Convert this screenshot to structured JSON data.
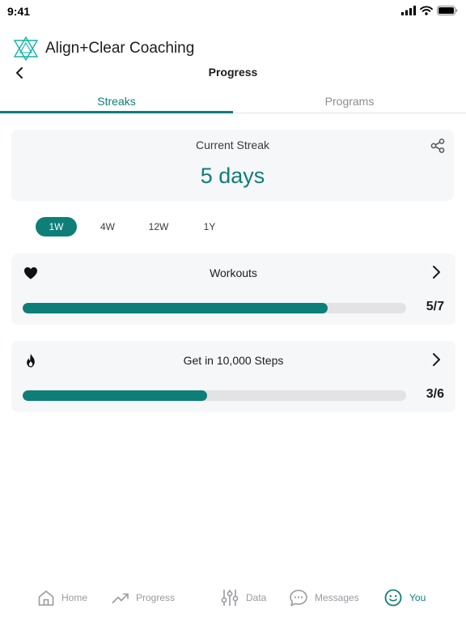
{
  "status_bar": {
    "time": "9:41"
  },
  "brand": {
    "name": "Align+Clear Coaching",
    "accent": "#13b3a8"
  },
  "header": {
    "title": "Progress"
  },
  "tabs": [
    {
      "label": "Streaks",
      "active": true
    },
    {
      "label": "Programs",
      "active": false
    }
  ],
  "streak": {
    "label": "Current Streak",
    "value": "5 days"
  },
  "ranges": [
    {
      "label": "1W",
      "active": true
    },
    {
      "label": "4W",
      "active": false
    },
    {
      "label": "12W",
      "active": false
    },
    {
      "label": "1Y",
      "active": false
    }
  ],
  "goals": [
    {
      "title": "Workouts",
      "icon": "heart-icon",
      "completed": 5,
      "total": 7,
      "count": "5/7",
      "progress": 0.795
    },
    {
      "title": "Get in 10,000 Steps",
      "icon": "flame-icon",
      "completed": 3,
      "total": 6,
      "count": "3/6",
      "progress": 0.48
    }
  ],
  "bottom_nav": [
    {
      "label": "Home",
      "icon": "home-icon",
      "active": false
    },
    {
      "label": "Progress",
      "icon": "trending-up-icon",
      "active": false
    },
    {
      "label": "Data",
      "icon": "sliders-icon",
      "active": false
    },
    {
      "label": "Messages",
      "icon": "chat-bubble-icon",
      "active": false
    },
    {
      "label": "You",
      "icon": "smiley-icon",
      "active": true
    }
  ],
  "colors": {
    "accent": "#0e7e78",
    "card_bg": "#f6f7f9",
    "track": "#e3e3e6",
    "inactive": "#9a9aa0"
  }
}
